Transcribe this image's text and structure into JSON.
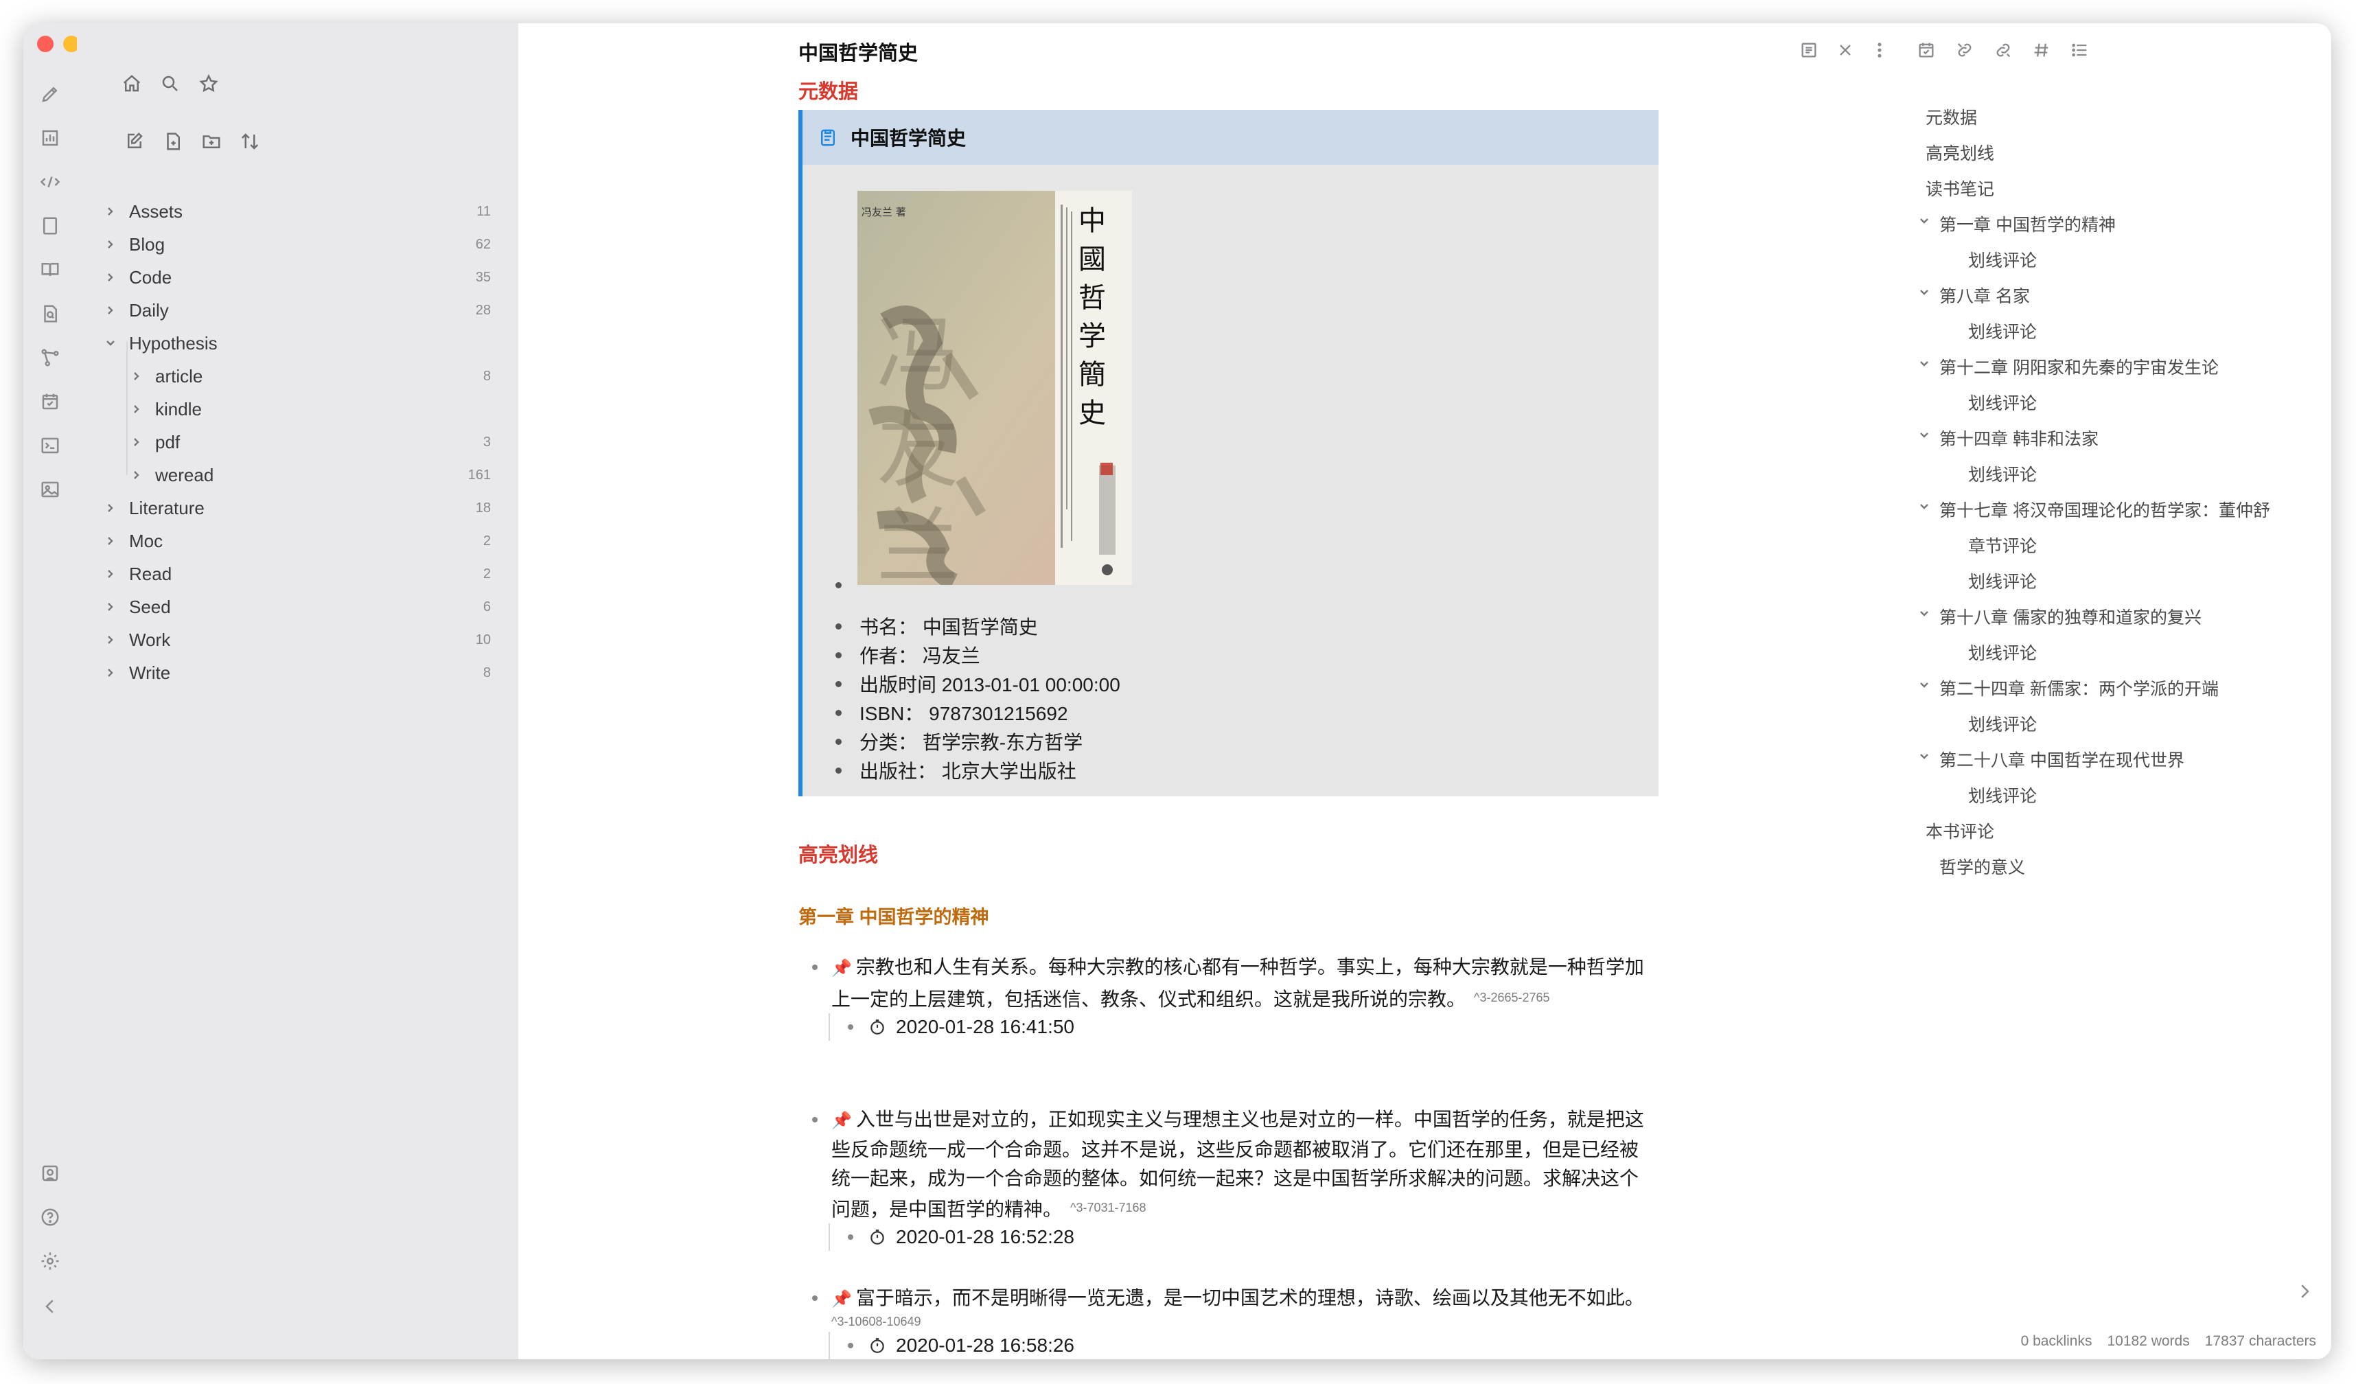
{
  "window": {
    "traffic_lights": {
      "close": "#ff5f57",
      "minimize": "#febc2e",
      "maximize": "#28c840"
    }
  },
  "ribbon": {
    "top_icons": [
      "pen-icon",
      "bar-chart-icon",
      "code-snippet-icon",
      "page-icon",
      "book-icon",
      "file-search-icon",
      "graph-icon",
      "calendar-check-icon",
      "terminal-icon",
      "image-icon"
    ],
    "bottom_icons": [
      "vault-icon",
      "help-icon",
      "settings-icon",
      "collapse-icon"
    ]
  },
  "sidebar": {
    "nav_icons": [
      "home-icon",
      "search-icon",
      "star-icon"
    ],
    "action_icons": [
      "new-note-icon",
      "new-file-icon",
      "new-folder-icon",
      "sort-icon"
    ],
    "tree": [
      {
        "label": "Assets",
        "count": "11",
        "level": 0,
        "expanded": false
      },
      {
        "label": "Blog",
        "count": "62",
        "level": 0,
        "expanded": false
      },
      {
        "label": "Code",
        "count": "35",
        "level": 0,
        "expanded": false
      },
      {
        "label": "Daily",
        "count": "28",
        "level": 0,
        "expanded": false
      },
      {
        "label": "Hypothesis",
        "count": "",
        "level": 0,
        "expanded": true
      },
      {
        "label": "article",
        "count": "8",
        "level": 1,
        "expanded": false
      },
      {
        "label": "kindle",
        "count": "",
        "level": 1,
        "expanded": false
      },
      {
        "label": "pdf",
        "count": "3",
        "level": 1,
        "expanded": false
      },
      {
        "label": "weread",
        "count": "161",
        "level": 1,
        "expanded": false
      },
      {
        "label": "Literature",
        "count": "18",
        "level": 0,
        "expanded": false
      },
      {
        "label": "Moc",
        "count": "2",
        "level": 0,
        "expanded": false
      },
      {
        "label": "Read",
        "count": "2",
        "level": 0,
        "expanded": false
      },
      {
        "label": "Seed",
        "count": "6",
        "level": 0,
        "expanded": false
      },
      {
        "label": "Work",
        "count": "10",
        "level": 0,
        "expanded": false
      },
      {
        "label": "Write",
        "count": "8",
        "level": 0,
        "expanded": false
      }
    ]
  },
  "editor": {
    "title": "中国哲学简史",
    "header_icons": [
      "reading-view-icon",
      "close-icon",
      "more-options-icon"
    ],
    "sections": {
      "metadata_heading": "元数据",
      "highlights_heading": "高亮划线",
      "chapter1_heading": "第一章 中国哲学的精神"
    },
    "callout": {
      "title": "中国哲学简史",
      "cover": {
        "author_small": "冯友兰 著",
        "spine_title": "中國哲学簡史",
        "brush_text": "冯友兰"
      },
      "meta": [
        "书名： 中国哲学简史",
        "作者： 冯友兰",
        "出版时间 2013-01-01 00:00:00",
        "ISBN： 9787301215692",
        "分类： 哲学宗教-东方哲学",
        "出版社： 北京大学出版社"
      ]
    },
    "highlights": [
      {
        "line1": "宗教也和人生有关系。每种大宗教的核心都有一种哲学。事实上，每种大宗教就是一种哲学加",
        "line2": "上一定的上层建筑，包括迷信、教条、仪式和组织。这就是我所说的宗教。",
        "ref": "^3-2665-2765",
        "time": "2020-01-28 16:41:50"
      },
      {
        "line1": "入世与出世是对立的，正如现实主义与理想主义也是对立的一样。中国哲学的任务，就是把这",
        "line2": "些反命题统一成一个合命题。这并不是说，这些反命题都被取消了。它们还在那里，但是已经被",
        "line3": "统一起来，成为一个合命题的整体。如何统一起来？这是中国哲学所求解决的问题。求解决这个",
        "line4": "问题，是中国哲学的精神。",
        "ref": "^3-7031-7168",
        "time": "2020-01-28 16:52:28"
      },
      {
        "line1": "富于暗示，而不是明晰得一览无遗，是一切中国艺术的理想，诗歌、绘画以及其他无不如此。",
        "ref": "^3-10608-10649",
        "time": "2020-01-28 16:58:26"
      }
    ]
  },
  "right_panel": {
    "tab_icons": [
      "calendar-check-icon",
      "backlink-icon",
      "outgoing-link-icon",
      "tag-icon",
      "outline-icon"
    ],
    "outline": [
      {
        "label": "元数据",
        "level": 0,
        "chevron": false
      },
      {
        "label": "高亮划线",
        "level": 0,
        "chevron": false
      },
      {
        "label": "读书笔记",
        "level": 0,
        "chevron": false
      },
      {
        "label": "第一章 中国哲学的精神",
        "level": 1,
        "chevron": true
      },
      {
        "label": "划线评论",
        "level": 2,
        "chevron": false
      },
      {
        "label": "第八章 名家",
        "level": 1,
        "chevron": true
      },
      {
        "label": "划线评论",
        "level": 2,
        "chevron": false
      },
      {
        "label": "第十二章 阴阳家和先秦的宇宙发生论",
        "level": 1,
        "chevron": true
      },
      {
        "label": "划线评论",
        "level": 2,
        "chevron": false
      },
      {
        "label": "第十四章 韩非和法家",
        "level": 1,
        "chevron": true
      },
      {
        "label": "划线评论",
        "level": 2,
        "chevron": false
      },
      {
        "label": "第十七章 将汉帝国理论化的哲学家：董仲舒",
        "level": 1,
        "chevron": true
      },
      {
        "label": "章节评论",
        "level": 2,
        "chevron": false
      },
      {
        "label": "划线评论",
        "level": 2,
        "chevron": false
      },
      {
        "label": "第十八章 儒家的独尊和道家的复兴",
        "level": 1,
        "chevron": true
      },
      {
        "label": "划线评论",
        "level": 2,
        "chevron": false
      },
      {
        "label": "第二十四章 新儒家：两个学派的开端",
        "level": 1,
        "chevron": true
      },
      {
        "label": "划线评论",
        "level": 2,
        "chevron": false
      },
      {
        "label": "第二十八章 中国哲学在现代世界",
        "level": 1,
        "chevron": true
      },
      {
        "label": "划线评论",
        "level": 2,
        "chevron": false
      },
      {
        "label": "本书评论",
        "level": 0,
        "chevron": false
      },
      {
        "label": "哲学的意义",
        "level": 1,
        "chevron": false
      }
    ]
  },
  "status_bar": {
    "backlinks": "0 backlinks",
    "words": "10182 words",
    "characters": "17837 characters"
  },
  "colors": {
    "heading_red": "#d8392f",
    "heading_orange": "#c06a0e",
    "callout_border": "#1e88e5",
    "callout_header": "#cddaea",
    "callout_body": "#e6e6e6",
    "pin": "#d6332b"
  }
}
